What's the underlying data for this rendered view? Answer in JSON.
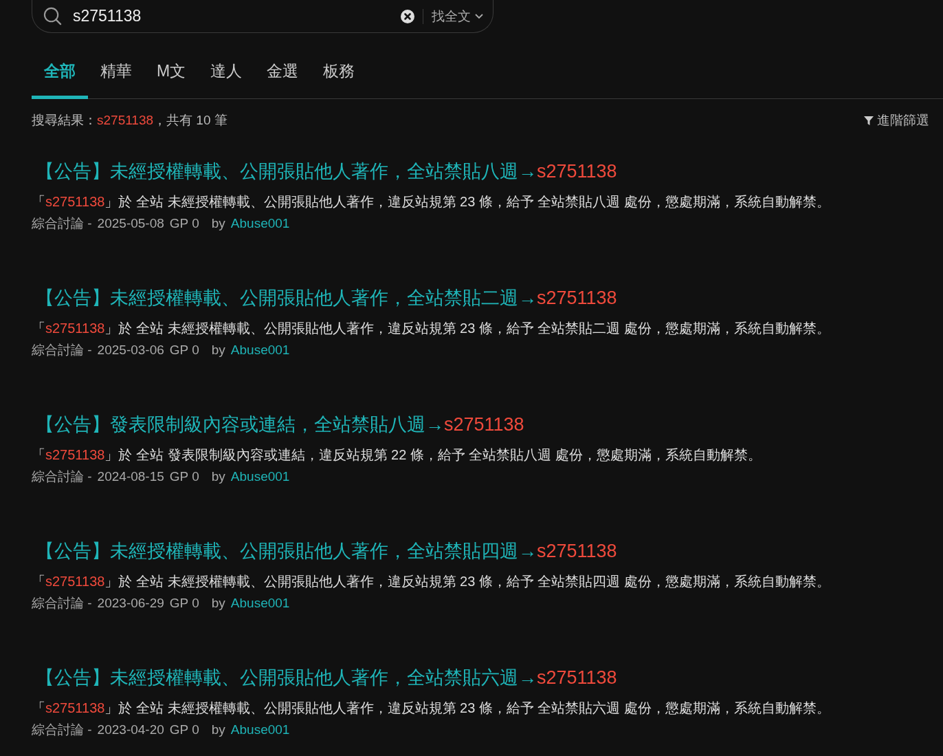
{
  "search": {
    "value": "s2751138",
    "scope": "找全文"
  },
  "tabs": [
    {
      "label": "全部",
      "selected": true
    },
    {
      "label": "精華",
      "selected": false
    },
    {
      "label": "M文",
      "selected": false
    },
    {
      "label": "達人",
      "selected": false
    },
    {
      "label": "金選",
      "selected": false
    },
    {
      "label": "板務",
      "selected": false
    }
  ],
  "summary": {
    "label": "搜尋結果：",
    "query": "s2751138",
    "count_text": "，共有 10 筆",
    "filter": "進階篩選"
  },
  "results": [
    {
      "title": "【公告】未經授權轉載、公開張貼他人著作，全站禁貼八週→",
      "title_hit": "s2751138",
      "quote_open": "「",
      "excerpt_hit": "s2751138",
      "excerpt": "」於 全站 未經授權轉載、公開張貼他人著作，違反站規第 23 條，給予 全站禁貼八週 處份，懲處期滿，系統自動解禁。",
      "board": "綜合討論",
      "dash": "-",
      "date": "2025-05-08",
      "gp": "GP 0",
      "by": "by",
      "author": "Abuse001"
    },
    {
      "title": "【公告】未經授權轉載、公開張貼他人著作，全站禁貼二週→",
      "title_hit": "s2751138",
      "quote_open": "「",
      "excerpt_hit": "s2751138",
      "excerpt": "」於 全站 未經授權轉載、公開張貼他人著作，違反站規第 23 條，給予 全站禁貼二週 處份，懲處期滿，系統自動解禁。",
      "board": "綜合討論",
      "dash": "-",
      "date": "2025-03-06",
      "gp": "GP 0",
      "by": "by",
      "author": "Abuse001"
    },
    {
      "title": "【公告】發表限制級內容或連結，全站禁貼八週→",
      "title_hit": "s2751138",
      "quote_open": "「",
      "excerpt_hit": "s2751138",
      "excerpt": "」於 全站 發表限制級內容或連結，違反站規第 22 條，給予 全站禁貼八週 處份，懲處期滿，系統自動解禁。",
      "board": "綜合討論",
      "dash": "-",
      "date": "2024-08-15",
      "gp": "GP 0",
      "by": "by",
      "author": "Abuse001"
    },
    {
      "title": "【公告】未經授權轉載、公開張貼他人著作，全站禁貼四週→",
      "title_hit": "s2751138",
      "quote_open": "「",
      "excerpt_hit": "s2751138",
      "excerpt": "」於 全站 未經授權轉載、公開張貼他人著作，違反站規第 23 條，給予 全站禁貼四週 處份，懲處期滿，系統自動解禁。",
      "board": "綜合討論",
      "dash": "-",
      "date": "2023-06-29",
      "gp": "GP 0",
      "by": "by",
      "author": "Abuse001"
    },
    {
      "title": "【公告】未經授權轉載、公開張貼他人著作，全站禁貼六週→",
      "title_hit": "s2751138",
      "quote_open": "「",
      "excerpt_hit": "s2751138",
      "excerpt": "」於 全站 未經授權轉載、公開張貼他人著作，違反站規第 23 條，給予 全站禁貼六週 處份，懲處期滿，系統自動解禁。",
      "board": "綜合討論",
      "dash": "-",
      "date": "2023-04-20",
      "gp": "GP 0",
      "by": "by",
      "author": "Abuse001"
    }
  ]
}
